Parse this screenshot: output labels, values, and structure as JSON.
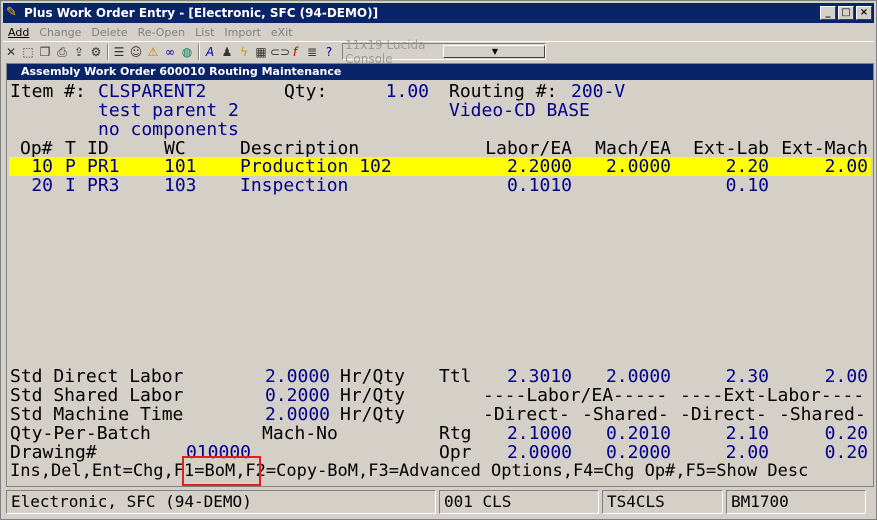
{
  "window": {
    "title": "Plus Work Order Entry - [Electronic, SFC (94-DEMO)]",
    "min": "_",
    "max": "□",
    "close": "×"
  },
  "menu": [
    {
      "label": "Add",
      "enabled": true
    },
    {
      "label": "Change",
      "enabled": false
    },
    {
      "label": "Delete",
      "enabled": false
    },
    {
      "label": "Re-Open",
      "enabled": false
    },
    {
      "label": "List",
      "enabled": false
    },
    {
      "label": "Import",
      "enabled": false
    },
    {
      "label": "eXit",
      "enabled": false
    }
  ],
  "toolbar": {
    "font_selector": "11x19 Lucida Console",
    "icons": [
      "close-icon",
      "select-icon",
      "copy-icon",
      "print-icon",
      "export-icon",
      "settings-icon",
      "list-icon",
      "users-icon",
      "warning-icon",
      "binoculars-icon",
      "globe-icon",
      "text-icon",
      "person-icon",
      "lightning-icon",
      "calc-icon",
      "link-icon",
      "function-icon",
      "notes-icon",
      "help-icon"
    ]
  },
  "screen": {
    "subtitle": "Assembly Work Order 600010 Routing Maintenance",
    "item_label": "Item #:",
    "item_value": "CLSPARENT2",
    "item_desc1": "test parent 2",
    "item_desc2": "no components",
    "qty_label": "Qty:",
    "qty_value": "1.00",
    "routing_label": "Routing #:",
    "routing_value": "200-V",
    "routing_desc": "Video-CD BASE",
    "headers": {
      "op": "Op#",
      "t": "T",
      "id": "ID",
      "wc": "WC",
      "desc": "Description",
      "labor": "Labor/EA",
      "mach": "Mach/EA",
      "extlab": "Ext-Lab",
      "extmach": "Ext-Mach"
    },
    "rows": [
      {
        "op": "10",
        "t": "P",
        "id": "PR1",
        "wc": "101",
        "desc": "Production 102",
        "labor": "2.2000",
        "mach": "2.0000",
        "extlab": "2.20",
        "extmach": "2.00",
        "selected": true
      },
      {
        "op": "20",
        "t": "I",
        "id": "PR3",
        "wc": "103",
        "desc": "Inspection",
        "labor": "0.1010",
        "mach": "",
        "extlab": "0.10",
        "extmach": "",
        "selected": false
      }
    ],
    "summary": {
      "std_direct_label": "Std Direct Labor",
      "std_direct_val": "2.0000",
      "std_direct_unit": "Hr/Qty",
      "std_shared_label": "Std Shared Labor",
      "std_shared_val": "0.2000",
      "std_shared_unit": "Hr/Qty",
      "std_machine_label": "Std Machine Time",
      "std_machine_val": "2.0000",
      "std_machine_unit": "Hr/Qty",
      "qty_per_batch_label": "Qty-Per-Batch",
      "mach_no_label": "Mach-No",
      "drawing_label": "Drawing#",
      "drawing_val": "010000",
      "ttl_label": "Ttl",
      "ttl_labor": "2.3010",
      "ttl_mach": "2.0000",
      "ttl_extlab": "2.30",
      "ttl_extmach": "2.00",
      "labor_ea_header": "----Labor/EA-----",
      "ext_labor_header": "----Ext-Labor----",
      "direct_h1": "-Direct-",
      "shared_h1": "-Shared-",
      "direct_h2": "-Direct-",
      "shared_h2": "-Shared-",
      "rtg_label": "Rtg",
      "rtg_direct": "2.1000",
      "rtg_shared": "0.2010",
      "rtg_extdirect": "2.10",
      "rtg_extshared": "0.20",
      "opr_label": "Opr",
      "opr_direct": "2.0000",
      "opr_shared": "0.2000",
      "opr_extdirect": "2.00",
      "opr_extshared": "0.20"
    },
    "keys": {
      "part1": "Ins,Del,Ent=Chg,",
      "f1": "F1=BoM",
      "part2": ",F2=Copy-BoM,F3=Advanced Options,F4=Chg Op#,F5=Show Desc"
    }
  },
  "statusbar": {
    "company": "Electronic, SFC (94-DEMO)",
    "user": "001 CLS",
    "station": "TS4CLS",
    "module": "BM1700"
  }
}
